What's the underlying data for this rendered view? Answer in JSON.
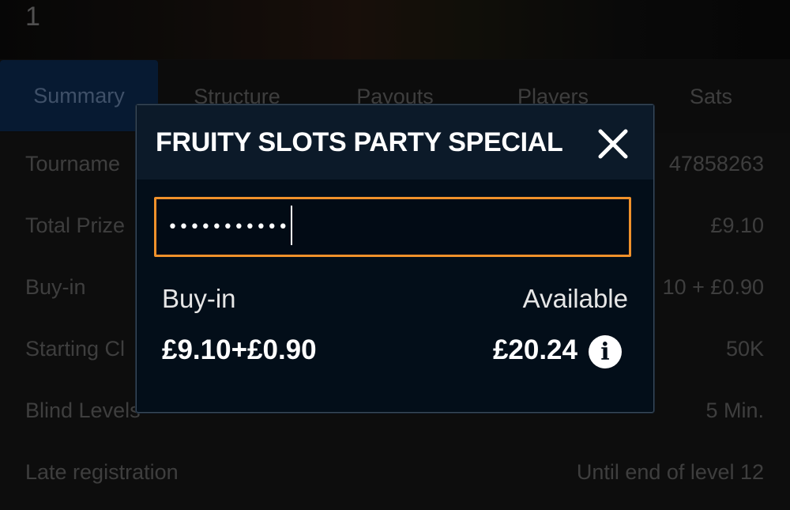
{
  "header": {
    "number": "1"
  },
  "tabs": [
    {
      "label": "Summary",
      "active": true
    },
    {
      "label": "Structure",
      "active": false
    },
    {
      "label": "Payouts",
      "active": false
    },
    {
      "label": "Players",
      "active": false
    },
    {
      "label": "Sats",
      "active": false
    }
  ],
  "details": [
    {
      "label": "Tourname",
      "value": "47858263"
    },
    {
      "label": "Total Prize",
      "value": "£9.10"
    },
    {
      "label": "Buy-in",
      "value": "10 + £0.90"
    },
    {
      "label": "Starting Cl",
      "value": "50K"
    },
    {
      "label": "Blind Levels",
      "value": "5 Min."
    },
    {
      "label": "Late registration",
      "value": "Until end of level 12"
    }
  ],
  "modal": {
    "title": "FRUITY SLOTS PARTY SPECIAL",
    "password_masked": "•••••••••••",
    "buyin_label": "Buy-in",
    "available_label": "Available",
    "buyin_value": "£9.10+£0.90",
    "available_value": "£20.24",
    "info_glyph": "i"
  },
  "icons": {
    "close": "close-icon",
    "info": "info-icon"
  },
  "colors": {
    "accent_border": "#f0912b",
    "active_tab": "#0d2d57",
    "modal_bg": "#030e19"
  }
}
